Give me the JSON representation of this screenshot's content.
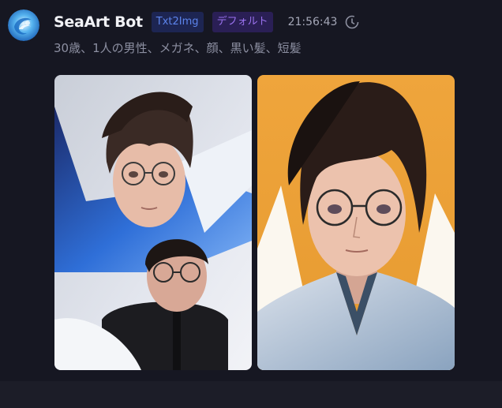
{
  "message": {
    "bot_name": "SeaArt Bot",
    "tags": [
      "Txt2Img",
      "デフォルト"
    ],
    "time": "21:56:43",
    "prompt": "30歳、1人の男性、メガネ、顔、黒い髪、短髪"
  },
  "icons": {
    "avatar": "seaart-logo-icon",
    "status": "clock-icon"
  },
  "colors": {
    "background": "#161722",
    "tag_txt2img_bg": "#1d2552",
    "tag_txt2img_text": "#5c84ec",
    "tag_default_bg": "#2a1f55",
    "tag_default_text": "#9a72ee",
    "image2_background": "#efa53c"
  },
  "images": [
    {
      "description_name": "generated-image-1"
    },
    {
      "description_name": "generated-image-2"
    }
  ]
}
